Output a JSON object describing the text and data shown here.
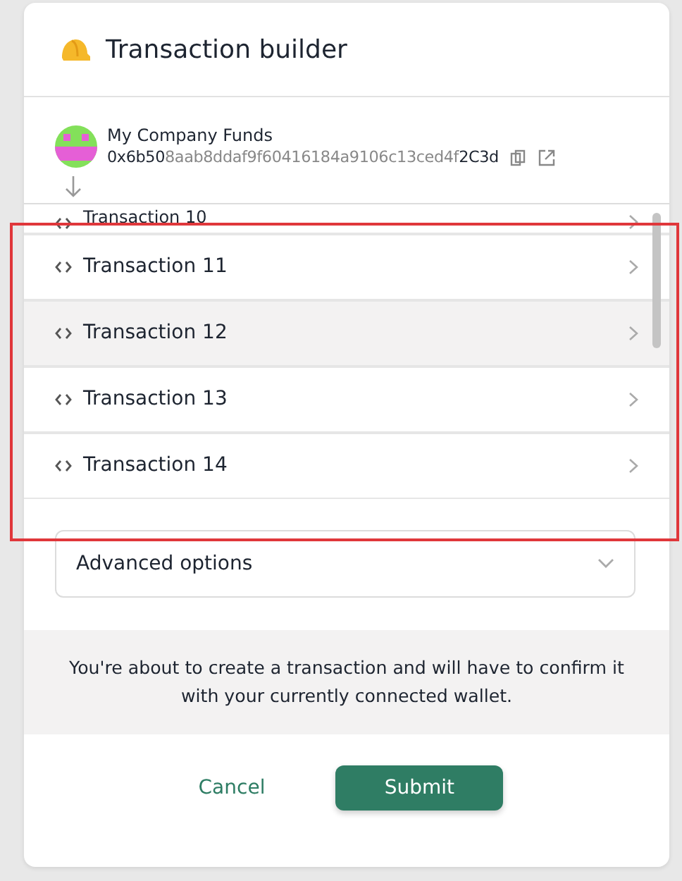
{
  "header": {
    "title": "Transaction builder"
  },
  "safe": {
    "name": "My Company Funds",
    "address": "**0x6b50**8aab8ddaf9f60416184a9106c13ced4f**2C3d**"
  },
  "transactions": [
    {
      "label": "Transaction 10",
      "selected": false
    },
    {
      "label": "Transaction 11",
      "selected": false
    },
    {
      "label": "Transaction 12",
      "selected": true
    },
    {
      "label": "Transaction 13",
      "selected": false
    },
    {
      "label": "Transaction 14",
      "selected": false
    }
  ],
  "advanced": {
    "label": "Advanced options",
    "expanded": false
  },
  "notice": "You're about to create a transaction and will have to confirm it with your currently connected wallet.",
  "buttons": {
    "cancel": "Cancel",
    "submit": "Submit"
  }
}
